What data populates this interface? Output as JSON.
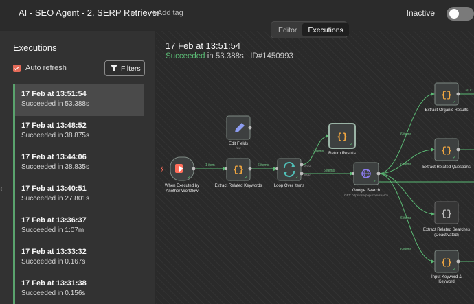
{
  "workflow": {
    "title": "AI - SEO Agent - 2. SERP Retriever",
    "add_tag": "+ Add tag",
    "status": "Inactive"
  },
  "tabs": [
    "Editor",
    "Executions"
  ],
  "sidebar": {
    "title": "Executions",
    "auto_refresh": "Auto refresh",
    "filters": "Filters",
    "executions": [
      {
        "date": "17 Feb at 13:51:54",
        "status": "Succeeded in 53.388s"
      },
      {
        "date": "17 Feb at 13:48:52",
        "status": "Succeeded in 38.875s"
      },
      {
        "date": "17 Feb at 13:44:06",
        "status": "Succeeded in 38.835s"
      },
      {
        "date": "17 Feb at 13:40:51",
        "status": "Succeeded in 27.801s"
      },
      {
        "date": "17 Feb at 13:36:37",
        "status": "Succeeded in 1:07m"
      },
      {
        "date": "17 Feb at 13:33:32",
        "status": "Succeeded in 0.167s"
      },
      {
        "date": "17 Feb at 13:31:38",
        "status": "Succeeded in 0.156s"
      }
    ]
  },
  "execution": {
    "date": "17 Feb at 13:51:54",
    "succeeded": "Succeeded",
    "duration": " in 53.388s | ID#1450993"
  },
  "nodes": {
    "trigger": {
      "label": "When Executed by Another Workflow"
    },
    "extract_keywords": {
      "label": "Extract Related Keywords"
    },
    "edit_fields": {
      "label": "Edit Fields",
      "sub": "raw"
    },
    "loop": {
      "label": "Loop Over Items",
      "out_done": "done",
      "out_loop": "loop"
    },
    "return_results": {
      "label": "Return Results"
    },
    "google_search": {
      "label": "Google Search",
      "sub": "GET: https://serpapi.com/search"
    },
    "extract_organic": {
      "label": "Extract Organic Results"
    },
    "extract_questions": {
      "label": "Extract Related Questions"
    },
    "extract_searches": {
      "label": "Extract Related Searches",
      "sub": "(Deactivated)"
    },
    "input_keyword": {
      "label": "Input Keyword & Keyword"
    }
  },
  "edges": {
    "e1": "1 item",
    "e2": "6 items",
    "e3": "6 items",
    "e4": "6 items",
    "e5": "6 items",
    "e6": "6 items",
    "e7": "6 items",
    "e8": "6 items",
    "e9": "30 it"
  },
  "colors": {
    "success": "#5bb974",
    "accent": "#e46a58",
    "node_bg": "#3d4040",
    "code_icon": "#f0a640",
    "trigger_icon": "#ff6d5a",
    "http_icon": "#8c7cf0"
  }
}
